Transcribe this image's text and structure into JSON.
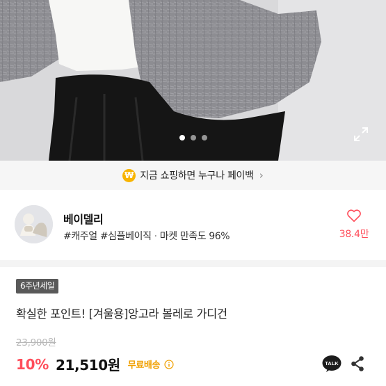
{
  "hero": {
    "slide_count": 3,
    "active_slide": 0,
    "expand_icon": "expand-icon"
  },
  "banner": {
    "coin_symbol": "₩",
    "text": "지금 쇼핑하면 누구나 페이백",
    "chevron": "›"
  },
  "shop": {
    "name": "베이델리",
    "tags": "#캐주얼 #심플베이직",
    "separator": "·",
    "satisfaction": "마켓 만족도 96%",
    "likes": "38.4만",
    "heart_color": "#ff4d5a"
  },
  "product": {
    "event_badge": "6주년세일",
    "title": "확실한 포인트! [겨울용]앙고라 볼레로 가디건",
    "original_price": "23,900원",
    "discount": "10%",
    "price": "21,510원",
    "shipping": "무료배송",
    "talk_label": "TALK"
  },
  "colors": {
    "accent_red": "#ff4d5a",
    "shipping_orange": "#f0a000",
    "coin_yellow": "#f8b400"
  }
}
